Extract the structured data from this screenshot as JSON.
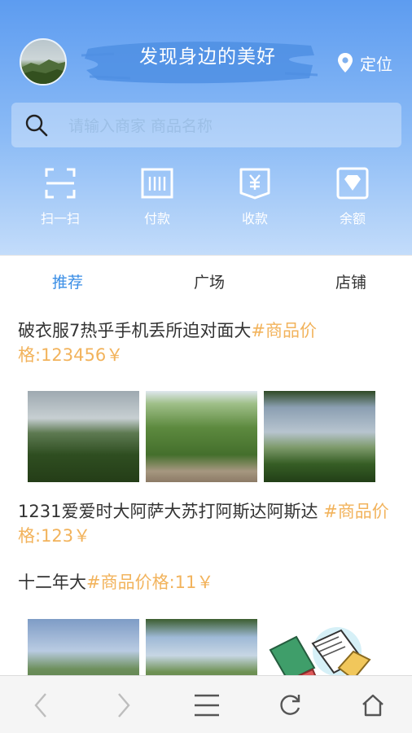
{
  "header": {
    "slogan": "发现身边的美好",
    "location_label": "定位",
    "search_placeholder": "请输入商家 商品名称",
    "gradient_colors": [
      "#5d9cf0",
      "#c3dcfa"
    ],
    "actions": [
      {
        "label": "扫一扫",
        "icon": "scan-icon"
      },
      {
        "label": "付款",
        "icon": "barcode-icon"
      },
      {
        "label": "收款",
        "icon": "yen-receipt-icon"
      },
      {
        "label": "余额",
        "icon": "diamond-icon"
      }
    ]
  },
  "tabs": [
    {
      "label": "推荐",
      "active": true
    },
    {
      "label": "广场",
      "active": false
    },
    {
      "label": "店铺",
      "active": false
    }
  ],
  "feed": {
    "accent_color": "#f2b35c",
    "posts": [
      {
        "title": "破衣服7热乎手机丢所迫对面大",
        "price_text": "#商品价格:123456￥"
      },
      {
        "title": "1231爱爱时大阿萨大苏打阿斯达阿斯达 ",
        "price_text": "#商品价格:123￥"
      },
      {
        "title": "十二年大",
        "price_text": "#商品价格:11￥"
      }
    ]
  },
  "browser_bar": {
    "buttons": [
      "back-icon",
      "forward-icon",
      "menu-icon",
      "refresh-icon",
      "home-icon"
    ]
  }
}
